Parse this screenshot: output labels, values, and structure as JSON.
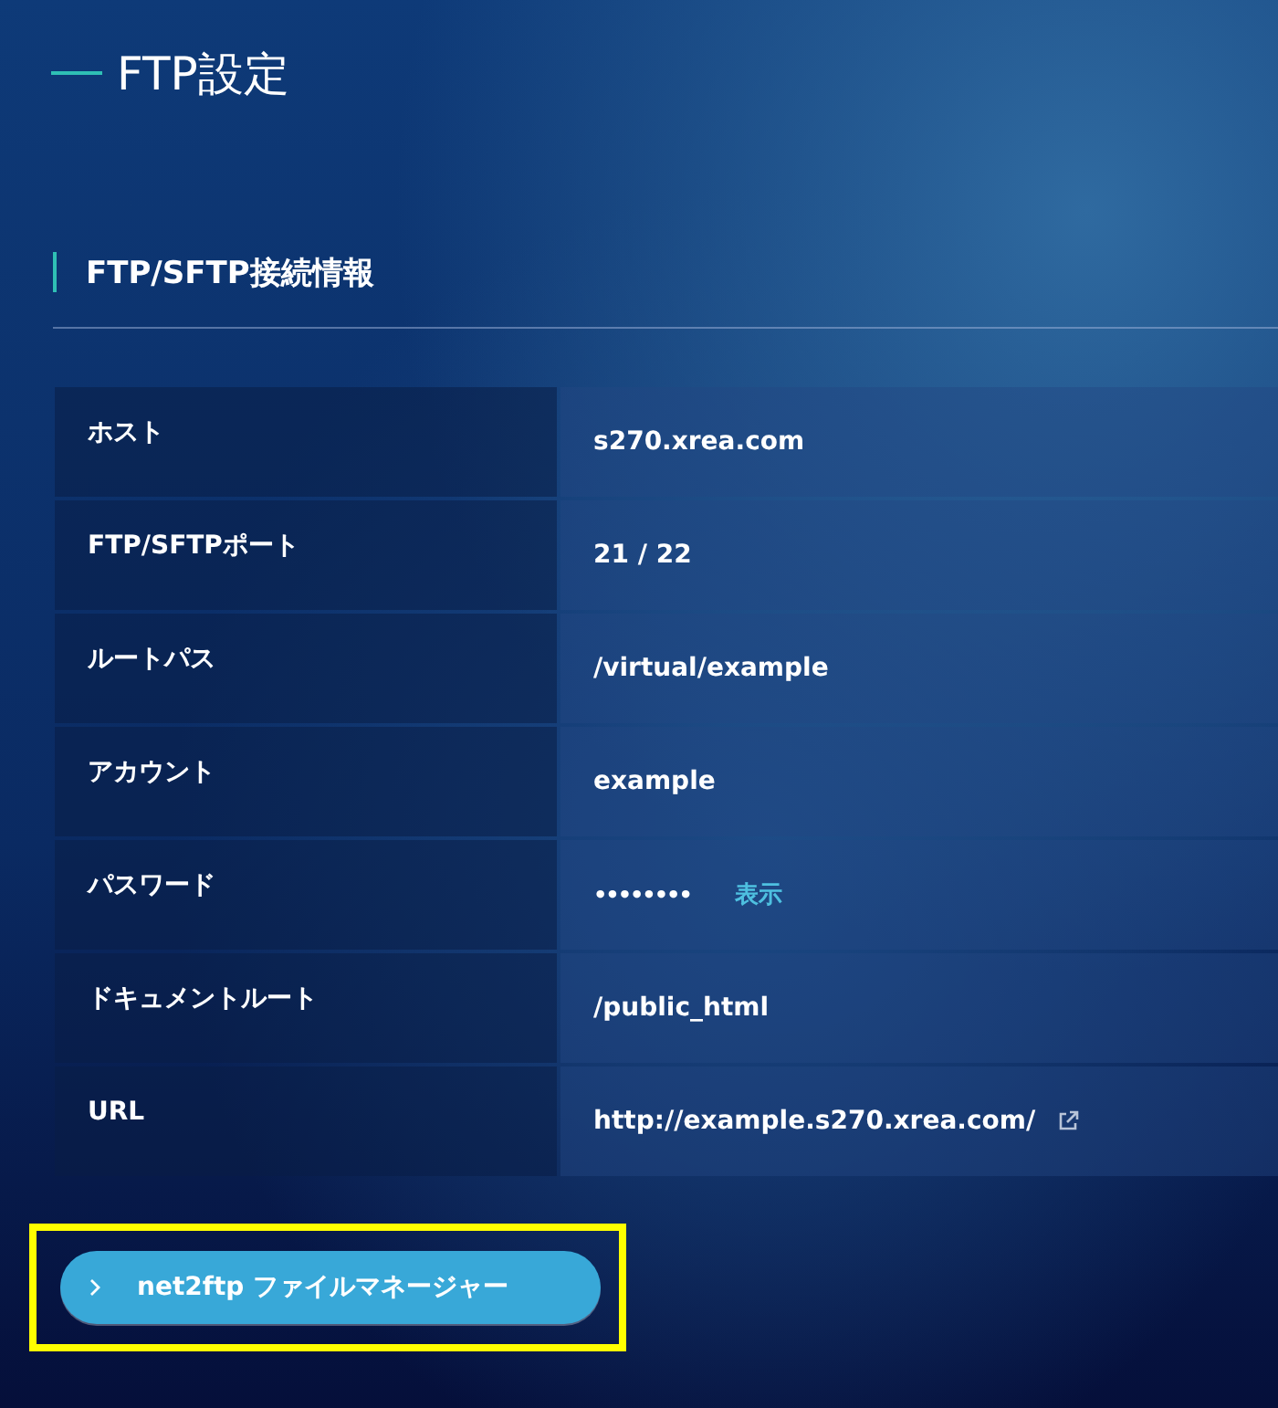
{
  "page_title": "FTP設定",
  "section": {
    "title": "FTP/SFTP接続情報",
    "rows": [
      {
        "kind": "text",
        "label": "ホスト",
        "value": "s270.xrea.com"
      },
      {
        "kind": "text",
        "label": "FTP/SFTPポート",
        "value": "21 / 22"
      },
      {
        "kind": "text",
        "label": "ルートパス",
        "value": "/virtual/example"
      },
      {
        "kind": "text",
        "label": "アカウント",
        "value": "example"
      },
      {
        "kind": "password",
        "label": "パスワード",
        "value": "••••••••",
        "action": "表示"
      },
      {
        "kind": "text",
        "label": "ドキュメントルート",
        "value": "/public_html"
      },
      {
        "kind": "link",
        "label": "URL",
        "value": "http://example.s270.xrea.com/"
      }
    ]
  },
  "button": {
    "label": "net2ftp ファイルマネージャー",
    "highlighted": true
  }
}
